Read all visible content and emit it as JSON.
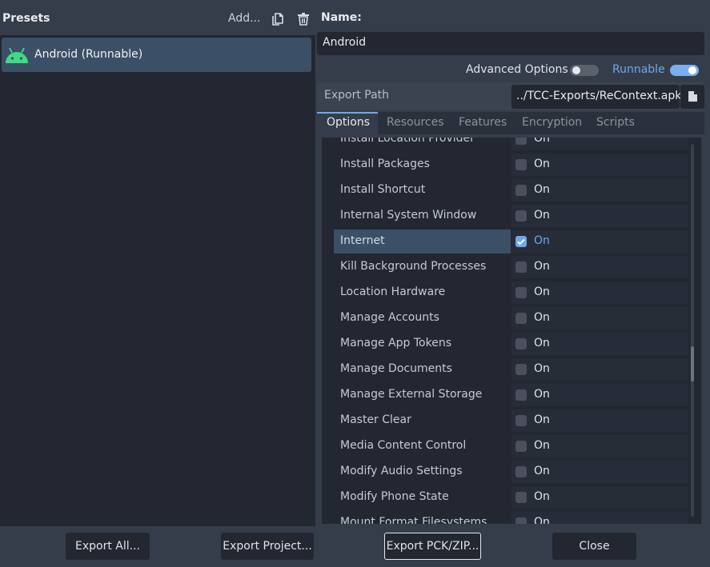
{
  "presets": {
    "title": "Presets",
    "add_label": "Add...",
    "items": [
      {
        "label": "Android (Runnable)",
        "icon": "android-icon",
        "selected": true
      }
    ]
  },
  "name": {
    "label": "Name:",
    "value": "Android"
  },
  "toggles": {
    "advanced_label": "Advanced Options",
    "advanced_on": false,
    "runnable_label": "Runnable",
    "runnable_on": true
  },
  "export_path": {
    "label": "Export Path",
    "value": "../TCC-Exports/ReContext.apk"
  },
  "tabs": [
    {
      "label": "Options",
      "active": true
    },
    {
      "label": "Resources",
      "active": false
    },
    {
      "label": "Features",
      "active": false
    },
    {
      "label": "Encryption",
      "active": false
    },
    {
      "label": "Scripts",
      "active": false
    }
  ],
  "options": [
    {
      "name": "Install Location Provider",
      "value": "On",
      "checked": false,
      "selected": false
    },
    {
      "name": "Install Packages",
      "value": "On",
      "checked": false,
      "selected": false
    },
    {
      "name": "Install Shortcut",
      "value": "On",
      "checked": false,
      "selected": false
    },
    {
      "name": "Internal System Window",
      "value": "On",
      "checked": false,
      "selected": false
    },
    {
      "name": "Internet",
      "value": "On",
      "checked": true,
      "selected": true
    },
    {
      "name": "Kill Background Processes",
      "value": "On",
      "checked": false,
      "selected": false
    },
    {
      "name": "Location Hardware",
      "value": "On",
      "checked": false,
      "selected": false
    },
    {
      "name": "Manage Accounts",
      "value": "On",
      "checked": false,
      "selected": false
    },
    {
      "name": "Manage App Tokens",
      "value": "On",
      "checked": false,
      "selected": false
    },
    {
      "name": "Manage Documents",
      "value": "On",
      "checked": false,
      "selected": false
    },
    {
      "name": "Manage External Storage",
      "value": "On",
      "checked": false,
      "selected": false
    },
    {
      "name": "Master Clear",
      "value": "On",
      "checked": false,
      "selected": false
    },
    {
      "name": "Media Content Control",
      "value": "On",
      "checked": false,
      "selected": false
    },
    {
      "name": "Modify Audio Settings",
      "value": "On",
      "checked": false,
      "selected": false
    },
    {
      "name": "Modify Phone State",
      "value": "On",
      "checked": false,
      "selected": false
    },
    {
      "name": "Mount Format Filesystems",
      "value": "On",
      "checked": false,
      "selected": false
    }
  ],
  "buttons": {
    "export_all": "Export All...",
    "export_project": "Export Project...",
    "export_pck": "Export PCK/ZIP...",
    "close": "Close"
  },
  "colors": {
    "accent": "#6ea8ec",
    "panel_dark": "#222731",
    "panel_base": "#363d4a",
    "selection": "#3b4f67",
    "android_green": "#3ddc84"
  }
}
